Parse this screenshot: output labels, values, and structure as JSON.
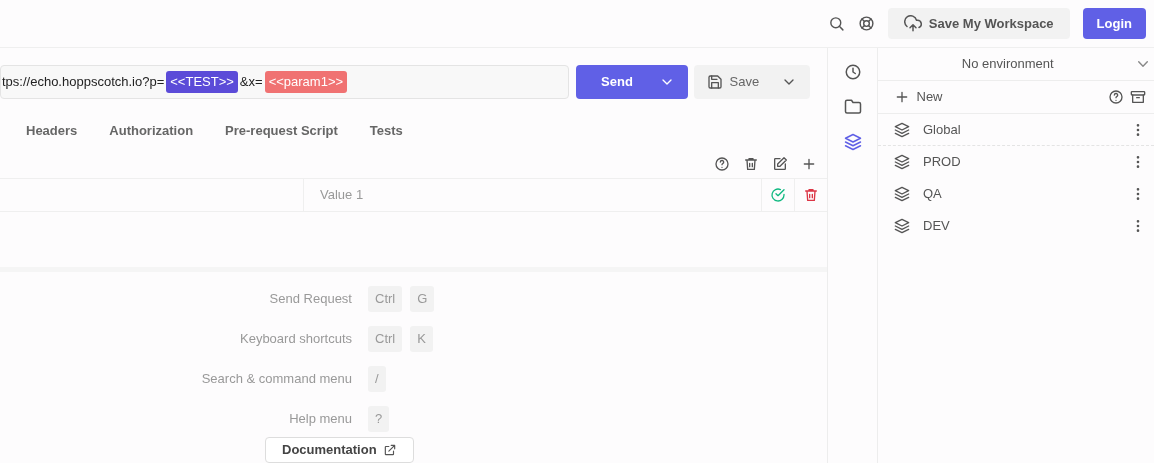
{
  "header": {
    "actions": [
      {
        "kind": "search"
      },
      {
        "kind": "help"
      }
    ],
    "save_workspace": "Save My Workspace",
    "login": "Login"
  },
  "request": {
    "url_segments": [
      {
        "kind": "text",
        "text": "tps://echo.hoppscotch.io?p="
      },
      {
        "kind": "variable",
        "text": "<<TEST>>",
        "color": "#5b4bd8"
      },
      {
        "kind": "text",
        "text": "&x="
      },
      {
        "kind": "variable",
        "text": "<<param1>>",
        "color": "#f07272"
      }
    ],
    "send": "Send",
    "save": "Save"
  },
  "tabs": [
    {
      "label": "Headers"
    },
    {
      "label": "Authorization"
    },
    {
      "label": "Pre-request Script"
    },
    {
      "label": "Tests"
    }
  ],
  "params_row": {
    "value_placeholder": "Value 1",
    "enabled": true
  },
  "shortcuts": [
    {
      "label": "Send Request",
      "keys": [
        "Ctrl",
        "G"
      ]
    },
    {
      "label": "Keyboard shortcuts",
      "keys": [
        "Ctrl",
        "K"
      ]
    },
    {
      "label": "Search & command menu",
      "keys": [
        "/"
      ]
    },
    {
      "label": "Help menu",
      "keys": [
        "?"
      ]
    }
  ],
  "documentation": "Documentation",
  "rail": [
    {
      "kind": "history",
      "selected": false
    },
    {
      "kind": "collections",
      "selected": false
    },
    {
      "kind": "environments",
      "selected": true
    }
  ],
  "environment_select": "No environment",
  "new_label": "New",
  "environments": [
    {
      "name": "Global"
    },
    {
      "name": "PROD"
    },
    {
      "name": "QA"
    },
    {
      "name": "DEV"
    }
  ]
}
